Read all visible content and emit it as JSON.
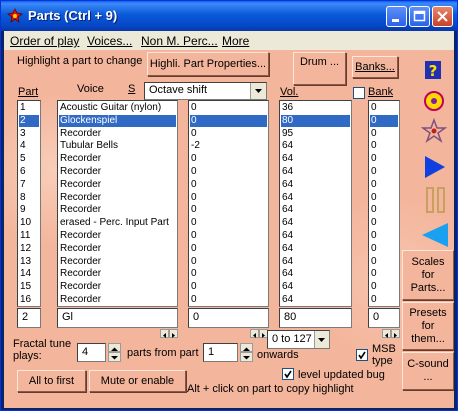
{
  "window": {
    "title": "Parts (Ctrl + 9)"
  },
  "menu": [
    {
      "label": "Order of play"
    },
    {
      "label": "Voices..."
    },
    {
      "label": "Non M. Perc..."
    },
    {
      "label": "More"
    }
  ],
  "header": {
    "hint": "Highlight a part to change",
    "highlight_props_button": "Highli. Part Properties...",
    "drum_button": "Drum ...",
    "banks_button": "Banks..."
  },
  "columns": {
    "part": "Part",
    "voice": "Voice",
    "s": "S",
    "vol": "Vol.",
    "bank": "Bank"
  },
  "octave_select": {
    "value": "Octave shift"
  },
  "rows": [
    {
      "part": "1",
      "voice": "Acoustic Guitar (nylon)",
      "octave": "0",
      "vol": "36",
      "bank": "0"
    },
    {
      "part": "2",
      "voice": "Glockenspiel",
      "octave": "0",
      "vol": "80",
      "bank": "0"
    },
    {
      "part": "3",
      "voice": "Recorder",
      "octave": "0",
      "vol": "95",
      "bank": "0"
    },
    {
      "part": "4",
      "voice": "Tubular Bells",
      "octave": "-2",
      "vol": "64",
      "bank": "0"
    },
    {
      "part": "5",
      "voice": "Recorder",
      "octave": "0",
      "vol": "64",
      "bank": "0"
    },
    {
      "part": "6",
      "voice": "Recorder",
      "octave": "0",
      "vol": "64",
      "bank": "0"
    },
    {
      "part": "7",
      "voice": "Recorder",
      "octave": "0",
      "vol": "64",
      "bank": "0"
    },
    {
      "part": "8",
      "voice": "Recorder",
      "octave": "0",
      "vol": "64",
      "bank": "0"
    },
    {
      "part": "9",
      "voice": "Recorder",
      "octave": "0",
      "vol": "64",
      "bank": "0"
    },
    {
      "part": "10",
      "voice": "erased - Perc. Input Part",
      "octave": "0",
      "vol": "64",
      "bank": "0"
    },
    {
      "part": "11",
      "voice": "Recorder",
      "octave": "0",
      "vol": "64",
      "bank": "0"
    },
    {
      "part": "12",
      "voice": "Recorder",
      "octave": "0",
      "vol": "64",
      "bank": "0"
    },
    {
      "part": "13",
      "voice": "Recorder",
      "octave": "0",
      "vol": "64",
      "bank": "0"
    },
    {
      "part": "14",
      "voice": "Recorder",
      "octave": "0",
      "vol": "64",
      "bank": "0"
    },
    {
      "part": "15",
      "voice": "Recorder",
      "octave": "0",
      "vol": "64",
      "bank": "0"
    },
    {
      "part": "16",
      "voice": "Recorder",
      "octave": "0",
      "vol": "64",
      "bank": "0"
    }
  ],
  "selected_row": 2,
  "edit_fields": {
    "part": "2",
    "voice": "Gl",
    "octave": "0",
    "vol": "80",
    "bank": "0"
  },
  "range_select": {
    "value": "0 to 127"
  },
  "msb": {
    "line1": "MSB",
    "line2": "type",
    "checked": true
  },
  "fractal": {
    "label_line1": "Fractal tune",
    "label_line2": "plays:",
    "count_value": "4",
    "parts_from_part": "parts from part",
    "from_value": "1",
    "onwards": "onwards"
  },
  "level_updated_bug": {
    "label": "level updated bug",
    "checked": true
  },
  "footer": {
    "all_to_first": "All to first",
    "mute_or_enable": "Mute or enable",
    "alt_click_hint": "Alt + click on part to copy highlight"
  },
  "side_buttons": {
    "scales": [
      "Scales",
      "for",
      "Parts..."
    ],
    "presets": [
      "Presets",
      "for",
      "them..."
    ],
    "csound": [
      "C-sound",
      "..."
    ]
  },
  "side_icons": [
    "help-icon",
    "target-icon",
    "star-icon",
    "play-icon",
    "pause-icon",
    "back-icon"
  ],
  "colors": {
    "panel": "#f3b59b",
    "selection": "#316ac5",
    "titlebar": "#0a5ad9",
    "play_icon": "#1040e0",
    "pause_icon": "#c8a060",
    "back_icon": "#1aa0f0"
  }
}
